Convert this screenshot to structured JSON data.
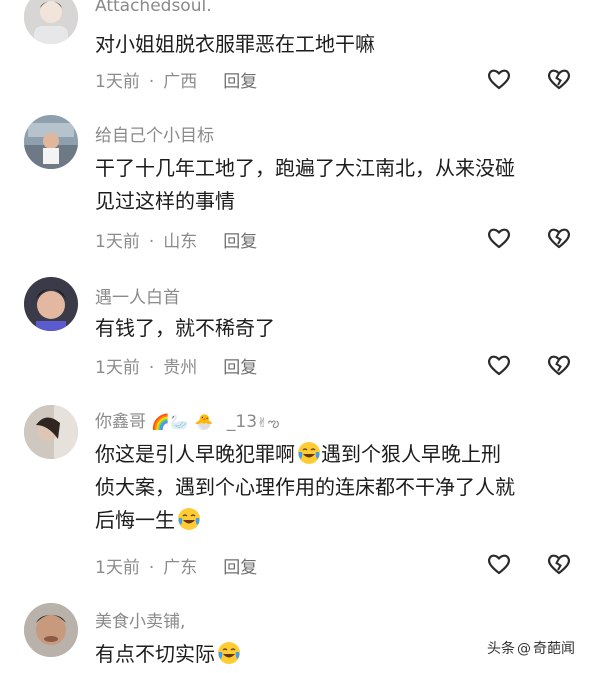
{
  "comments": [
    {
      "username": "Attachedsoul.",
      "lines": [
        "对小姐姐脱衣服罪恶在工地干嘛"
      ],
      "time": "1天前",
      "location": "广西",
      "reply": "回复"
    },
    {
      "username": "给自己个小目标",
      "lines": [
        "干了十几年工地了，跑遍了大江南北，从来没碰",
        "见过这样的事情"
      ],
      "time": "1天前",
      "location": "山东",
      "reply": "回复"
    },
    {
      "username": "遇一人白首",
      "lines": [
        "有钱了，就不稀奇了"
      ],
      "time": "1天前",
      "location": "贵州",
      "reply": "回复"
    },
    {
      "username": "你鑫哥",
      "username_suffix": "_13",
      "lines": [
        "你这是引人早晚犯罪啊",
        "遇到个狠人早晚上刑",
        "侦大案，遇到个心理作用的连床都不干净了人就",
        "后悔一生"
      ],
      "time": "1天前",
      "location": "广东",
      "reply": "回复"
    },
    {
      "username": "美食小卖铺,",
      "lines": [
        "有点不切实际"
      ],
      "time": "",
      "location": "",
      "reply": ""
    }
  ],
  "watermark": {
    "source": "头条",
    "at": "@",
    "author": "奇葩闻"
  },
  "icons": {
    "like": "heart-outline-icon",
    "dislike": "broken-heart-icon",
    "emoji": "crying-laughing-emoji"
  },
  "colors": {
    "text": "#1c1c1c",
    "meta": "#8c8c8c",
    "icon": "#2a2a2a"
  }
}
